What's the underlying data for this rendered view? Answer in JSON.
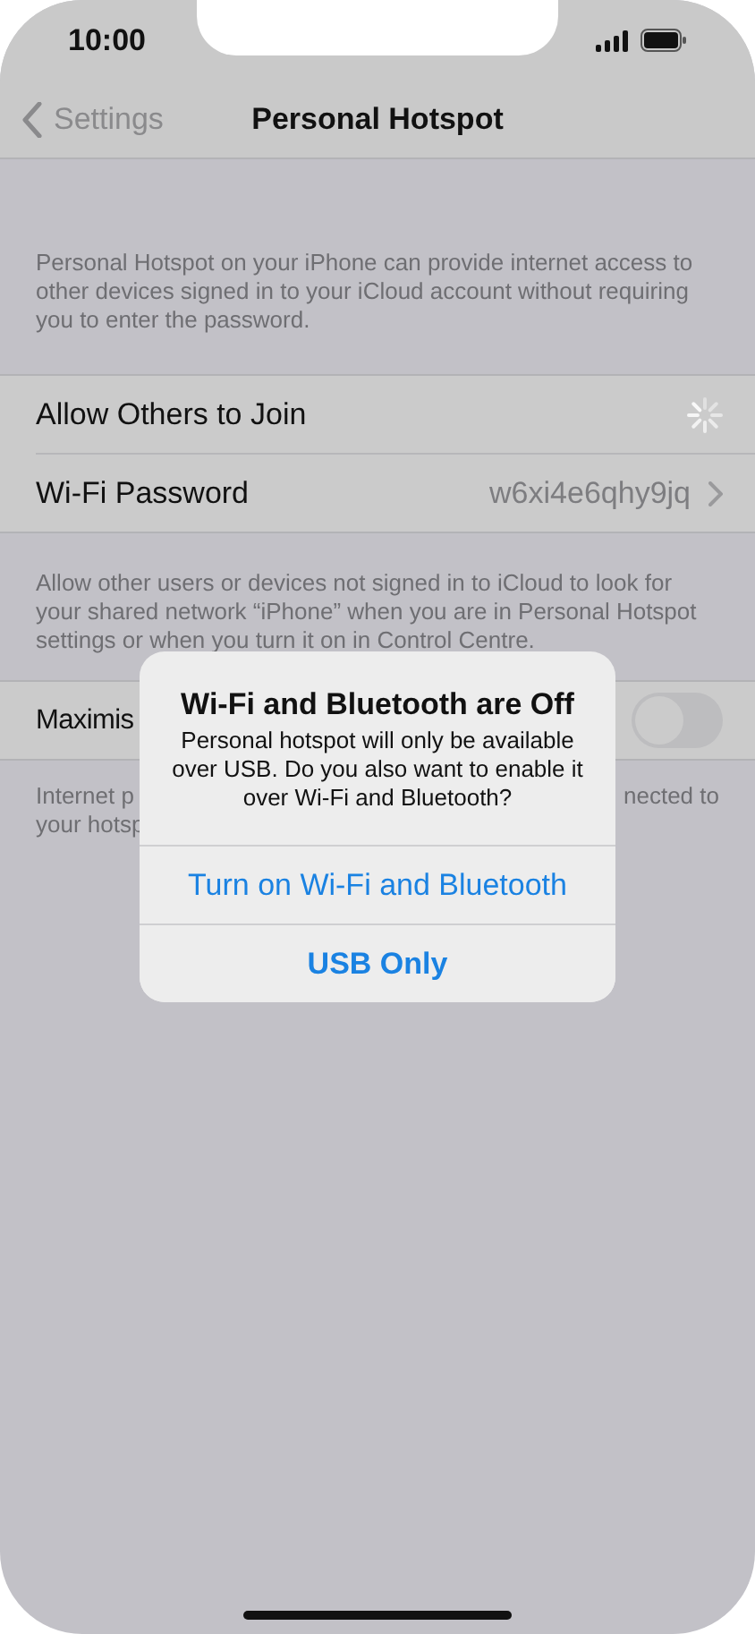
{
  "status_bar": {
    "time": "10:00"
  },
  "nav": {
    "back": "Settings",
    "title": "Personal Hotspot"
  },
  "intro": "Personal Hotspot on your iPhone can provide internet access to other devices signed in to your iCloud account without requiring you to enter the password.",
  "group": [
    {
      "kind": "spinner",
      "label": "Allow Others to Join"
    },
    {
      "kind": "link",
      "label": "Wi-Fi Password",
      "value": "w6xi4e6qhy9jq"
    }
  ],
  "group_footer": "Allow other users or devices not signed in to iCloud to look for your shared network “iPhone” when you are in Personal Hotspot settings or when you turn it on in Control Centre.",
  "maximise": {
    "label": "Maximis",
    "on": false
  },
  "maximise_footer": {
    "left_lines": [
      "Internet p",
      "your hotsp"
    ],
    "right": "nected to"
  },
  "alert": {
    "title": "Wi-Fi and Bluetooth are Off",
    "message": "Personal hotspot will only be available over USB. Do you also want to enable it over Wi-Fi and Bluetooth?",
    "actions": [
      {
        "label": "Turn on Wi-Fi and Bluetooth",
        "bold": false
      },
      {
        "label": "USB Only",
        "bold": true
      }
    ]
  }
}
